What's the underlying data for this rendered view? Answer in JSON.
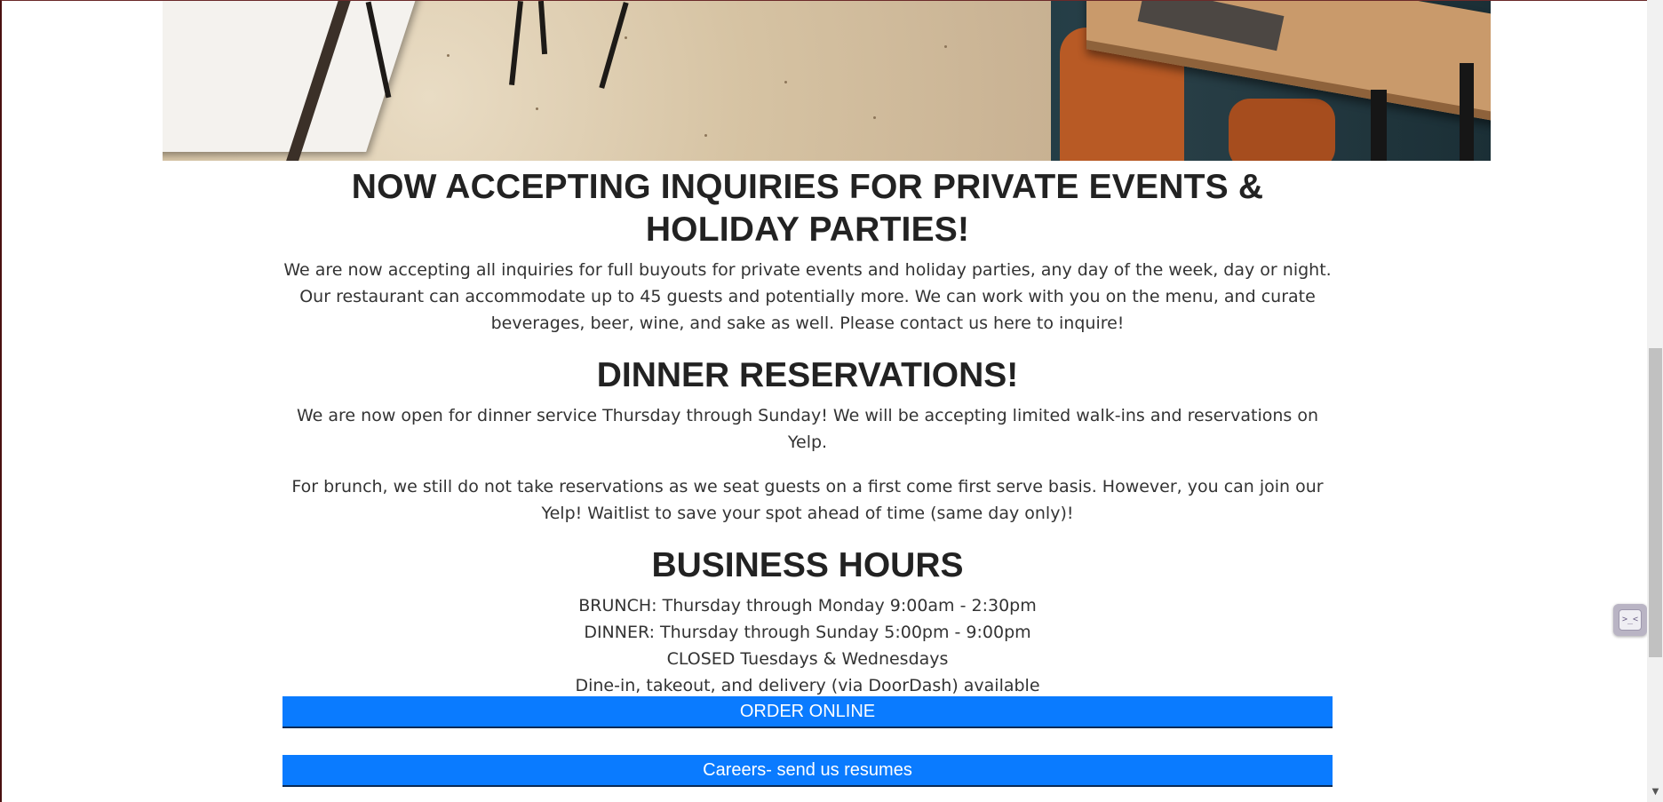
{
  "hero": {
    "image_name": "restaurant-interior-photo"
  },
  "events": {
    "heading": "NOW ACCEPTING INQUIRIES FOR PRIVATE EVENTS & HOLIDAY PARTIES!",
    "body": "We are now accepting all inquiries for full buyouts for private events and holiday parties, any day of the week, day or night. Our restaurant can accommodate up to 45 guests and potentially more. We can work with you on the menu, and curate beverages, beer, wine, and sake as well. Please contact us here to inquire!"
  },
  "dinner": {
    "heading": "DINNER RESERVATIONS!",
    "body1": "We are now open for dinner service Thursday through Sunday! We will be accepting limited walk-ins and reservations on Yelp.",
    "body2": "For brunch, we still do not take reservations as we seat guests on a first come first serve basis. However, you can join our Yelp! Waitlist to save your spot ahead of time (same day only)!"
  },
  "hours": {
    "heading": "BUSINESS HOURS",
    "lines": [
      "BRUNCH: Thursday through Monday 9:00am - 2:30pm",
      "DINNER: Thursday through Sunday 5:00pm - 9:00pm",
      "CLOSED Tuesdays & Wednesdays",
      "Dine-in, takeout, and delivery (via DoorDash) available"
    ]
  },
  "buttons": {
    "order_online": "ORDER ONLINE",
    "careers": "Careers- send us resumes"
  },
  "widget": {
    "icon": "terminal-icon",
    "glyph": ">_<"
  },
  "colors": {
    "button_blue": "#0a7bff",
    "heading": "#222222",
    "body_text": "#333333"
  }
}
